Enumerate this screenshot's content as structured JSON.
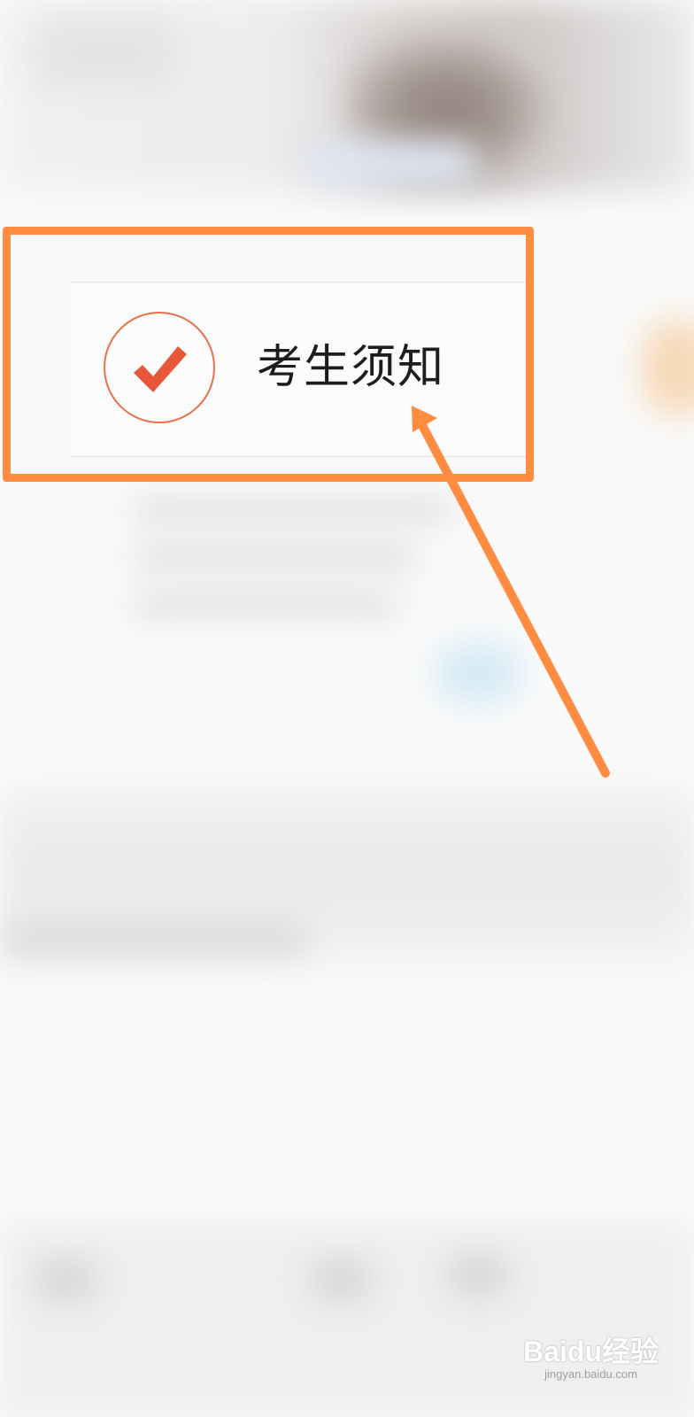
{
  "notice_card": {
    "label": "考生须知",
    "icon": "checkmark-icon",
    "accent_color": "#e9704c"
  },
  "annotation": {
    "highlight_color": "#ff8c40"
  },
  "watermark": {
    "logo": "Baidu经验",
    "url": "jingyan.baidu.com"
  }
}
